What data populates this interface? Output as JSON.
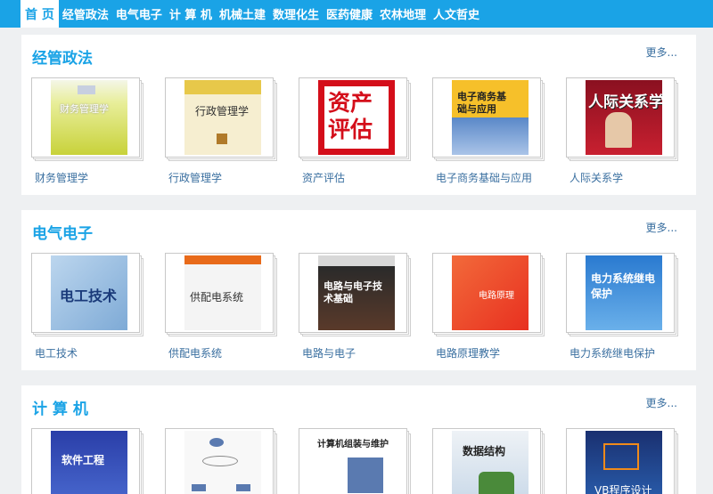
{
  "nav": {
    "items": [
      "首 页",
      "经管政法",
      "电气电子",
      "计 算 机",
      "机械土建",
      "数理化生",
      "医药健康",
      "农林地理",
      "人文哲史"
    ]
  },
  "more_label": "更多...",
  "sections": [
    {
      "title": "经管政法",
      "books": [
        {
          "title": "财务管理学",
          "cover_text": "财务管理学"
        },
        {
          "title": "行政管理学",
          "cover_text": "行政管理学"
        },
        {
          "title": "资产评估",
          "cover_text": "资产评估"
        },
        {
          "title": "电子商务基础与应用",
          "cover_text": "电子商务基础与应用"
        },
        {
          "title": "人际关系学",
          "cover_text": "人际关系学"
        }
      ]
    },
    {
      "title": "电气电子",
      "books": [
        {
          "title": "电工技术",
          "cover_text": "电工技术"
        },
        {
          "title": "供配电系统",
          "cover_text": "供配电系统"
        },
        {
          "title": "电路与电子",
          "cover_text": "电路与电子技术基础"
        },
        {
          "title": "电路原理教学",
          "cover_text": "电路原理"
        },
        {
          "title": "电力系统继电保护",
          "cover_text": "电力系统继电保护"
        }
      ]
    },
    {
      "title": "计 算 机",
      "books": [
        {
          "title": "",
          "cover_text": "软件工程"
        },
        {
          "title": "",
          "cover_text": ""
        },
        {
          "title": "",
          "cover_text": "计算机组装与维护"
        },
        {
          "title": "",
          "cover_text": "数据结构"
        },
        {
          "title": "",
          "cover_text": "VB程序设计"
        }
      ]
    }
  ],
  "colors": {
    "nav_bg": "#1aa3e6",
    "section_title": "#1aa3e6",
    "link": "#3a6fa0"
  }
}
